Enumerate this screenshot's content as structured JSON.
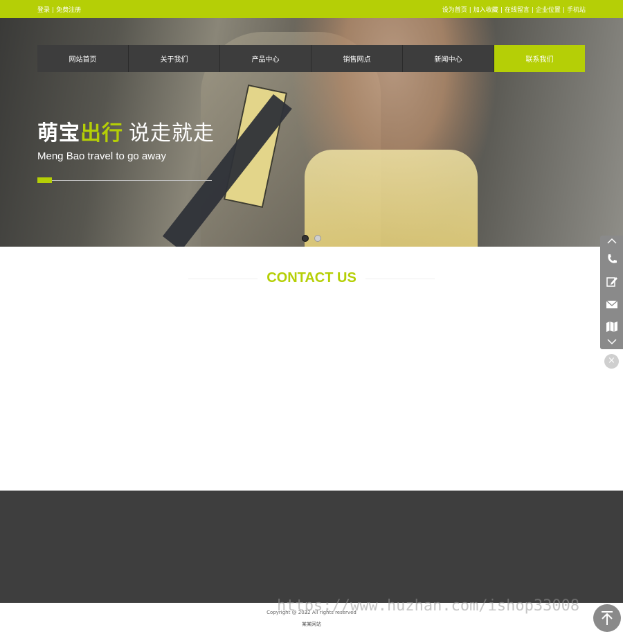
{
  "topbar": {
    "left": [
      "登录",
      "免费注册"
    ],
    "right": [
      "设为首页",
      "加入收藏",
      "在线留言",
      "企业位置",
      "手机站"
    ],
    "color": "#b5cf06"
  },
  "nav": {
    "items": [
      "网站首页",
      "关于我们",
      "产品中心",
      "销售网点",
      "新闻中心",
      "联系我们"
    ],
    "active_index": 5
  },
  "hero": {
    "slogan_a": "萌宝",
    "slogan_b": "出行",
    "slogan_c": "说走就走",
    "subtitle": "Meng Bao travel to go away",
    "slides": 2,
    "active_slide": 1
  },
  "section": {
    "title": "CONTACT US"
  },
  "sidebar": {
    "icons": [
      "chevron-up-icon",
      "phone-icon",
      "edit-icon",
      "mail-icon",
      "map-icon",
      "chevron-down-icon"
    ]
  },
  "footer": {
    "copyright": "Copyright @ 2022 All rights reserved",
    "link": "某某网站",
    "watermark": "https://www.huzhan.com/ishop33008"
  }
}
